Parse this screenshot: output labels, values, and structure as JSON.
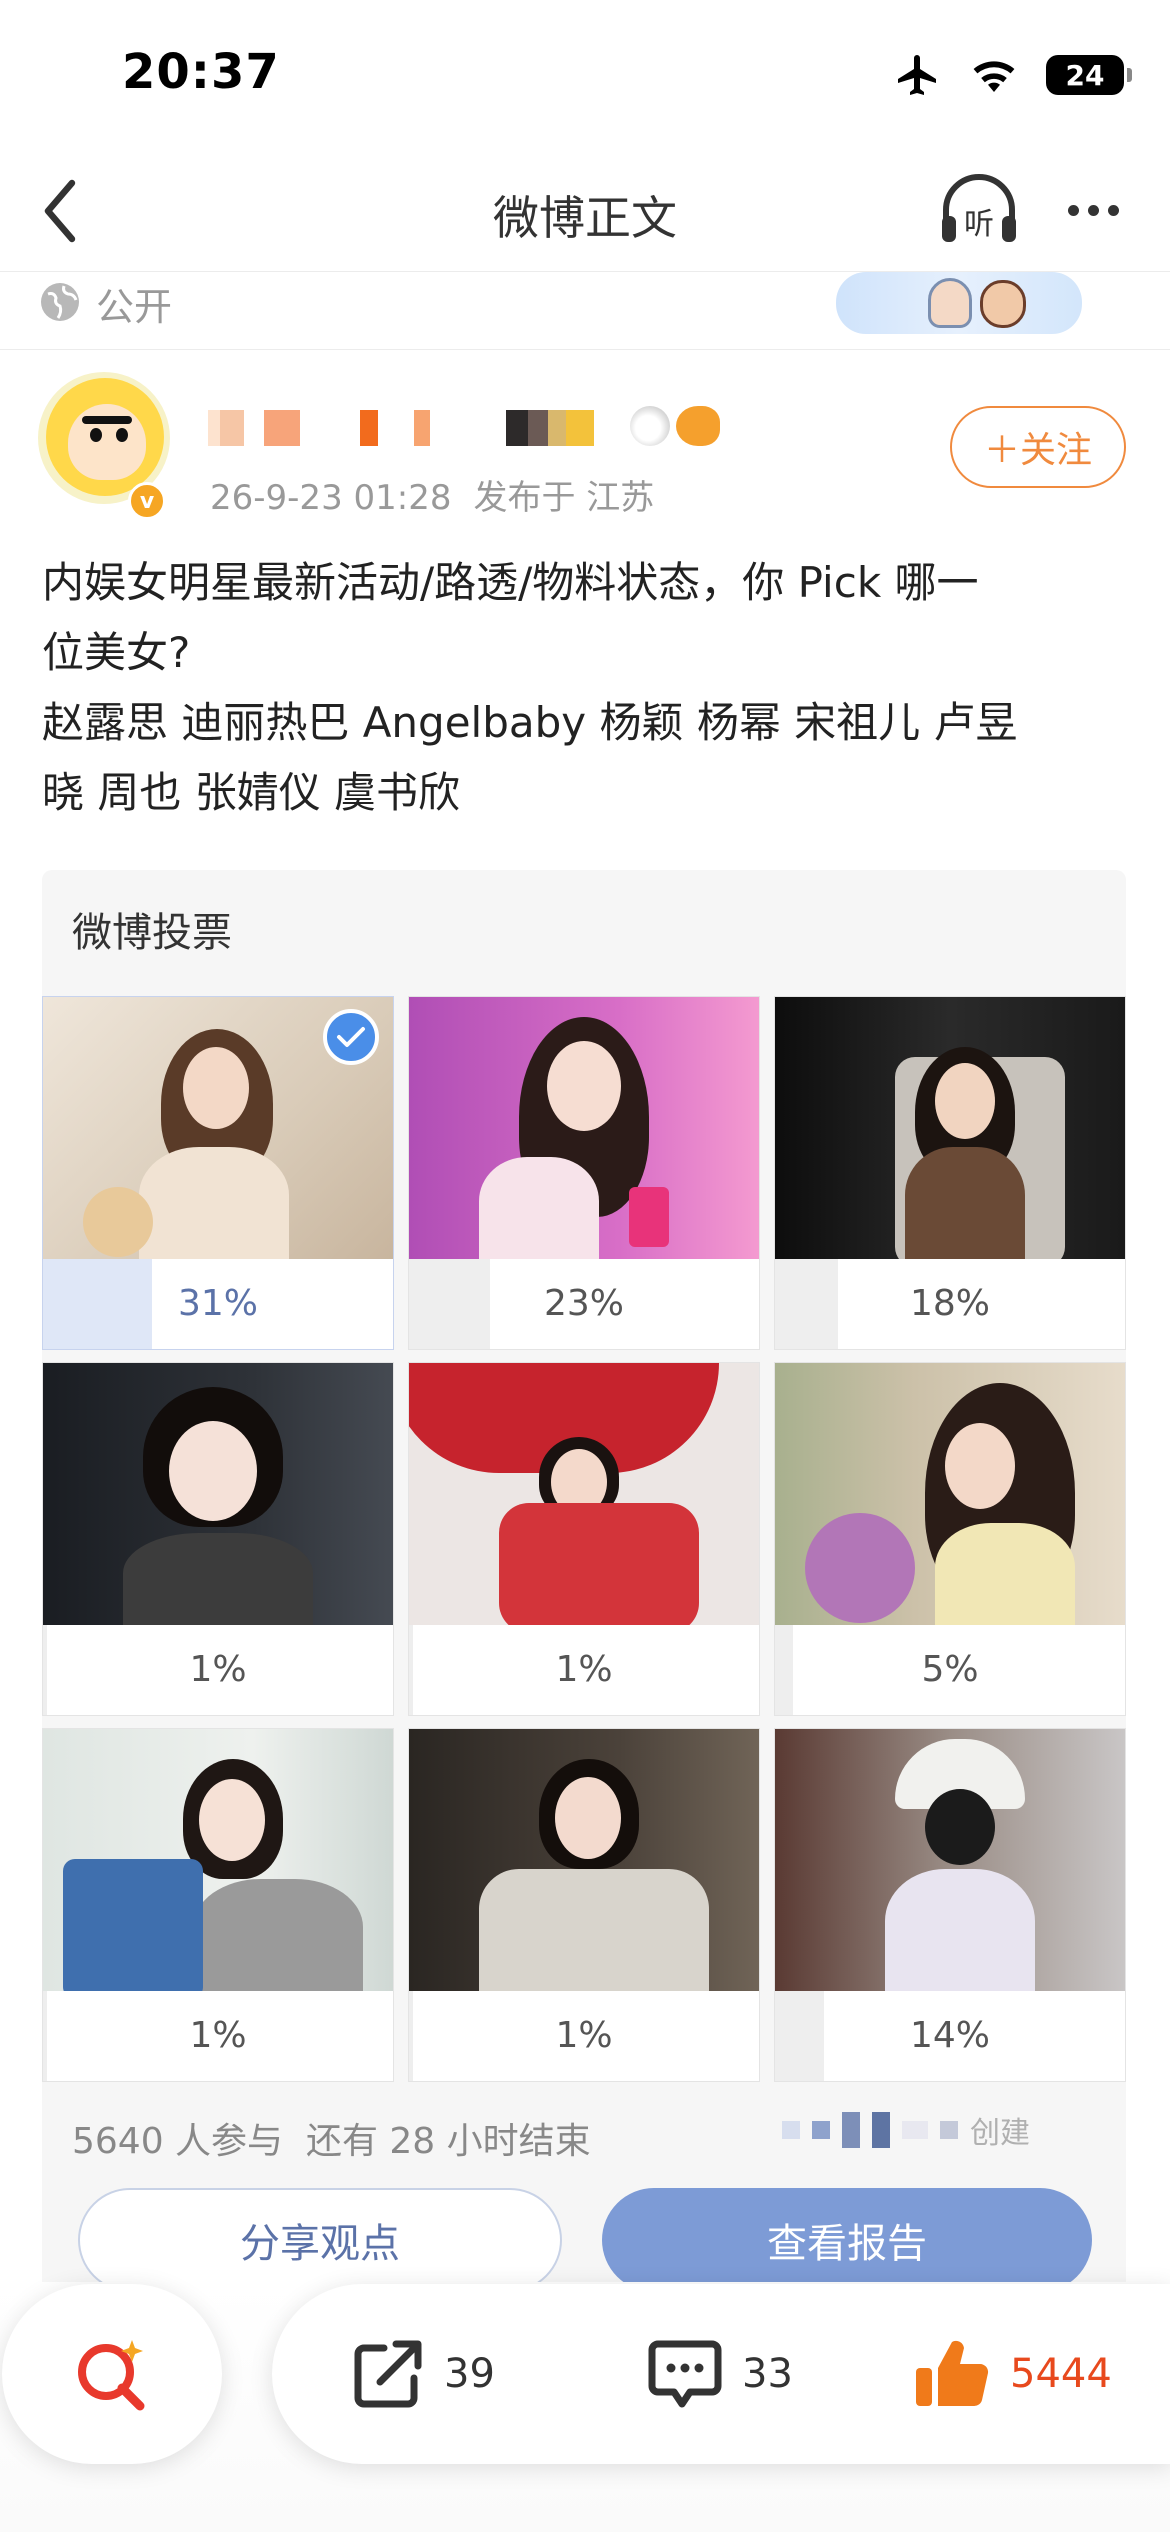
{
  "status_bar": {
    "time": "20:37",
    "battery": "24",
    "icons": [
      "airplane-icon",
      "wifi-icon",
      "battery-icon"
    ]
  },
  "nav": {
    "title": "微博正文",
    "icons": [
      "back-icon",
      "listen-icon",
      "more-icon"
    ],
    "listen_label": "听"
  },
  "visibility": {
    "label": "公开"
  },
  "author": {
    "meta_time": "26-9-23 01:28",
    "meta_location": "发布于 江苏",
    "verified_mark": "v",
    "follow_label": "＋关注"
  },
  "post": {
    "lines": [
      "内娱女明星最新活动/路透/物料状态，你 Pick 哪一",
      "位美女?",
      "赵露思 迪丽热巴 Angelbaby 杨颖 杨幂 宋祖儿 卢昱",
      "晓 周也 张婧仪  虞书欣"
    ]
  },
  "vote": {
    "title": "微博投票",
    "options": [
      {
        "percent": "31%",
        "value": 0.31,
        "selected": true
      },
      {
        "percent": "23%",
        "value": 0.23,
        "selected": false
      },
      {
        "percent": "18%",
        "value": 0.18,
        "selected": false
      },
      {
        "percent": "1%",
        "value": 0.01,
        "selected": false
      },
      {
        "percent": "1%",
        "value": 0.01,
        "selected": false
      },
      {
        "percent": "5%",
        "value": 0.05,
        "selected": false
      },
      {
        "percent": "1%",
        "value": 0.01,
        "selected": false
      },
      {
        "percent": "1%",
        "value": 0.01,
        "selected": false
      },
      {
        "percent": "14%",
        "value": 0.14,
        "selected": false
      }
    ],
    "participants": "5640 人参与",
    "remaining": "还有 28 小时结束",
    "brand_suffix": "创建",
    "share_label": "分享观点",
    "report_label": "查看报告"
  },
  "actions": {
    "repost_count": "39",
    "comment_count": "33",
    "like_count": "5444"
  },
  "colors": {
    "accent_orange": "#f08a3e",
    "like_red": "#e8491d",
    "vote_blue": "#7d9bd6",
    "vote_selected_fill": "#dfe7f7"
  }
}
